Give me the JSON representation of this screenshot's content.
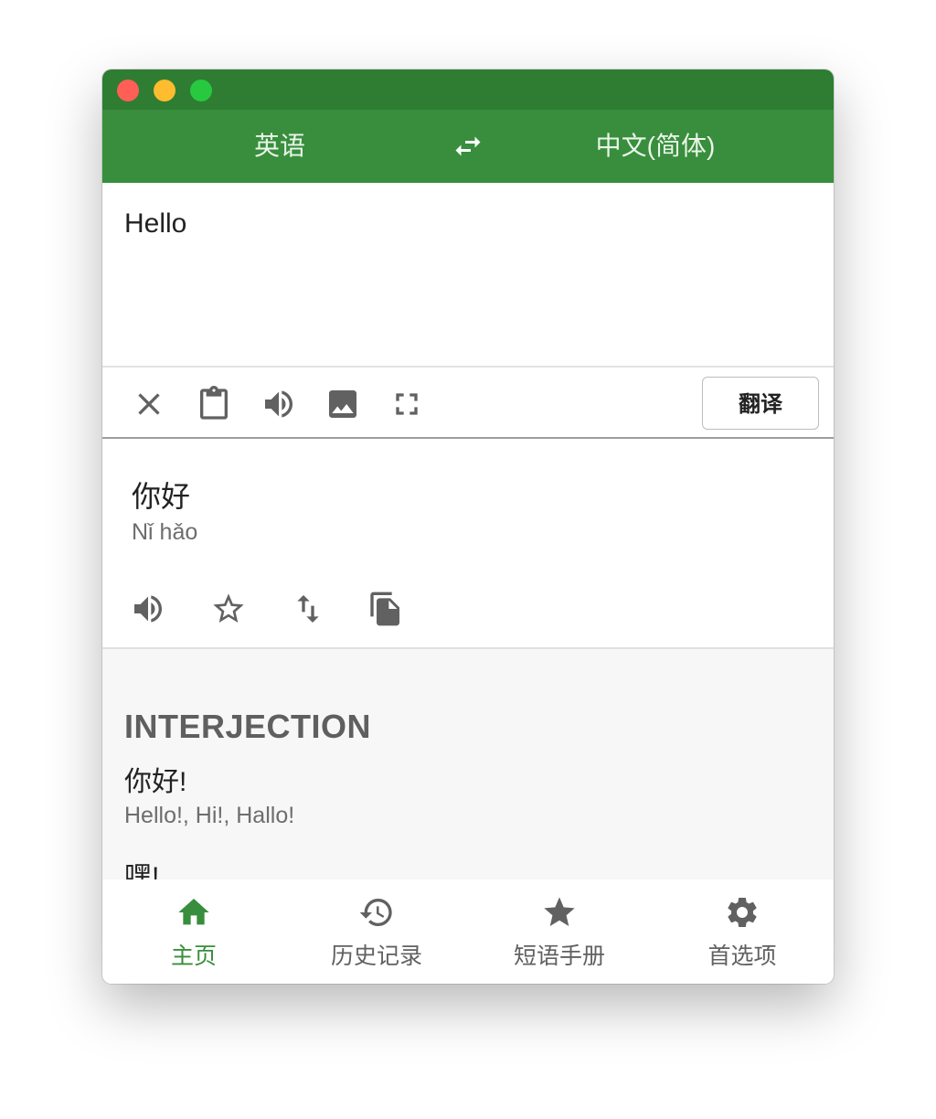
{
  "header": {
    "source_language": "英语",
    "target_language": "中文(简体)",
    "swap_icon": "swap-horiz-icon"
  },
  "input": {
    "text": "Hello"
  },
  "toolbar": {
    "icons": [
      "clear-icon",
      "clipboard-icon",
      "speaker-icon",
      "image-icon",
      "fullscreen-icon"
    ],
    "translate_label": "翻译"
  },
  "result": {
    "text": "你好",
    "pinyin": "Nǐ hǎo",
    "icons": [
      "speaker-icon",
      "star-outline-icon",
      "swap-vert-icon",
      "copy-icon"
    ]
  },
  "dictionary": {
    "part_of_speech": "INTERJECTION",
    "entries": [
      {
        "word": "你好!",
        "synonyms": "Hello!, Hi!, Hallo!"
      },
      {
        "word": "嘿!",
        "synonyms": ""
      }
    ]
  },
  "nav": {
    "items": [
      {
        "label": "主页",
        "icon": "home-icon",
        "active": true
      },
      {
        "label": "历史记录",
        "icon": "history-icon",
        "active": false
      },
      {
        "label": "短语手册",
        "icon": "star-icon",
        "active": false
      },
      {
        "label": "首选项",
        "icon": "settings-icon",
        "active": false
      }
    ]
  },
  "colors": {
    "titlebar": "#2e7d32",
    "header": "#388e3c",
    "active_nav": "#388e3c",
    "icon_gray": "#616161"
  }
}
